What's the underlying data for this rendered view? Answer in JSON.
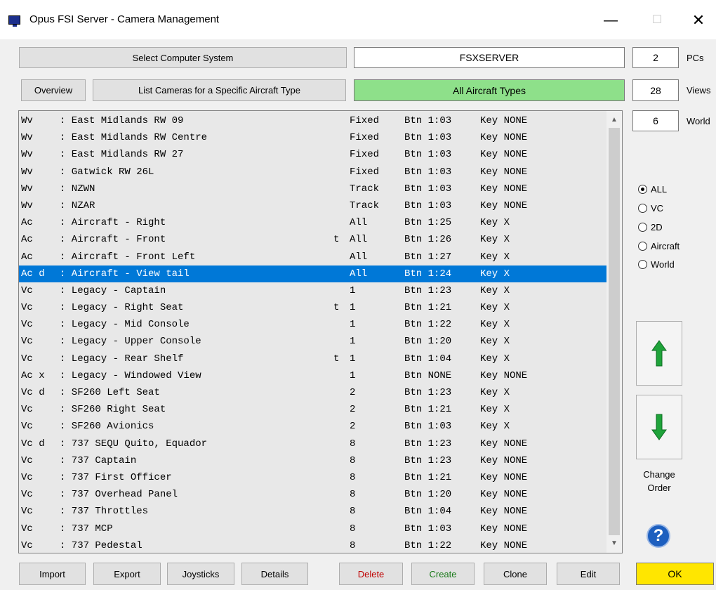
{
  "window": {
    "title": "Opus FSI Server - Camera Management",
    "minimize": "—",
    "maximize": "☐",
    "close": "✕"
  },
  "header": {
    "select_system_label": "Select Computer System",
    "system_value": "FSXSERVER",
    "pcs_count": "2",
    "pcs_label": "PCs",
    "overview_label": "Overview",
    "list_cameras_label": "List Cameras for a Specific Aircraft Type",
    "aircraft_filter": "All Aircraft Types",
    "views_count": "28",
    "views_label": "Views",
    "world_count": "6",
    "world_label": "World"
  },
  "camera_list": {
    "selected_index": 9,
    "rows": [
      {
        "type": "Wv  ",
        "name": ": East Midlands RW 09",
        "flag": "",
        "view": "Fixed",
        "btn": "Btn 1:03",
        "key": "Key NONE"
      },
      {
        "type": "Wv  ",
        "name": ": East Midlands RW Centre",
        "flag": "",
        "view": "Fixed",
        "btn": "Btn 1:03",
        "key": "Key NONE"
      },
      {
        "type": "Wv  ",
        "name": ": East Midlands RW 27",
        "flag": "",
        "view": "Fixed",
        "btn": "Btn 1:03",
        "key": "Key NONE"
      },
      {
        "type": "Wv  ",
        "name": ": Gatwick RW 26L",
        "flag": "",
        "view": "Fixed",
        "btn": "Btn 1:03",
        "key": "Key NONE"
      },
      {
        "type": "Wv  ",
        "name": ": NZWN",
        "flag": "",
        "view": "Track",
        "btn": "Btn 1:03",
        "key": "Key NONE"
      },
      {
        "type": "Wv  ",
        "name": ": NZAR",
        "flag": "",
        "view": "Track",
        "btn": "Btn 1:03",
        "key": "Key NONE"
      },
      {
        "type": "Ac  ",
        "name": ": Aircraft - Right",
        "flag": "",
        "view": "All",
        "btn": "Btn 1:25",
        "key": "Key X"
      },
      {
        "type": "Ac  ",
        "name": ": Aircraft - Front",
        "flag": "t",
        "view": "All",
        "btn": "Btn 1:26",
        "key": "Key X"
      },
      {
        "type": "Ac  ",
        "name": ": Aircraft - Front Left",
        "flag": "",
        "view": "All",
        "btn": "Btn 1:27",
        "key": "Key X"
      },
      {
        "type": "Ac d",
        "name": ": Aircraft - View tail",
        "flag": "",
        "view": "All",
        "btn": "Btn 1:24",
        "key": "Key X"
      },
      {
        "type": "Vc  ",
        "name": ": Legacy - Captain",
        "flag": "",
        "view": "1",
        "btn": "Btn 1:23",
        "key": "Key X"
      },
      {
        "type": "Vc  ",
        "name": ": Legacy - Right Seat",
        "flag": "t",
        "view": "1",
        "btn": "Btn 1:21",
        "key": "Key X"
      },
      {
        "type": "Vc  ",
        "name": ": Legacy - Mid Console",
        "flag": "",
        "view": "1",
        "btn": "Btn 1:22",
        "key": "Key X"
      },
      {
        "type": "Vc  ",
        "name": ": Legacy - Upper Console",
        "flag": "",
        "view": "1",
        "btn": "Btn 1:20",
        "key": "Key X"
      },
      {
        "type": "Vc  ",
        "name": ": Legacy - Rear Shelf",
        "flag": "t",
        "view": "1",
        "btn": "Btn 1:04",
        "key": "Key X"
      },
      {
        "type": "Ac x",
        "name": ": Legacy - Windowed View",
        "flag": "",
        "view": "1",
        "btn": "Btn NONE",
        "key": "Key NONE"
      },
      {
        "type": "Vc d",
        "name": ": SF260 Left Seat",
        "flag": "",
        "view": "2",
        "btn": "Btn 1:23",
        "key": "Key X"
      },
      {
        "type": "Vc  ",
        "name": ": SF260 Right Seat",
        "flag": "",
        "view": "2",
        "btn": "Btn 1:21",
        "key": "Key X"
      },
      {
        "type": "Vc  ",
        "name": ": SF260 Avionics",
        "flag": "",
        "view": "2",
        "btn": "Btn 1:03",
        "key": "Key X"
      },
      {
        "type": "Vc d",
        "name": ": 737 SEQU Quito, Equador",
        "flag": "",
        "view": "8",
        "btn": "Btn 1:23",
        "key": "Key NONE"
      },
      {
        "type": "Vc  ",
        "name": ": 737 Captain",
        "flag": "",
        "view": "8",
        "btn": "Btn 1:23",
        "key": "Key NONE"
      },
      {
        "type": "Vc  ",
        "name": ": 737 First Officer",
        "flag": "",
        "view": "8",
        "btn": "Btn 1:21",
        "key": "Key NONE"
      },
      {
        "type": "Vc  ",
        "name": ": 737 Overhead Panel",
        "flag": "",
        "view": "8",
        "btn": "Btn 1:20",
        "key": "Key NONE"
      },
      {
        "type": "Vc  ",
        "name": ": 737 Throttles",
        "flag": "",
        "view": "8",
        "btn": "Btn 1:04",
        "key": "Key NONE"
      },
      {
        "type": "Vc  ",
        "name": ": 737 MCP",
        "flag": "",
        "view": "8",
        "btn": "Btn 1:03",
        "key": "Key NONE"
      },
      {
        "type": "Vc  ",
        "name": ": 737 Pedestal",
        "flag": "",
        "view": "8",
        "btn": "Btn 1:22",
        "key": "Key NONE"
      }
    ]
  },
  "filter_options": [
    {
      "label": "ALL",
      "selected": true
    },
    {
      "label": "VC",
      "selected": false
    },
    {
      "label": "2D",
      "selected": false
    },
    {
      "label": "Aircraft",
      "selected": false
    },
    {
      "label": "World",
      "selected": false
    }
  ],
  "order": {
    "label_line1": "Change",
    "label_line2": "Order",
    "up_icon": "arrow-up-icon",
    "down_icon": "arrow-down-icon"
  },
  "help": {
    "glyph": "?"
  },
  "footer": {
    "import_label": "Import",
    "export_label": "Export",
    "joysticks_label": "Joysticks",
    "details_label": "Details",
    "delete_label": "Delete",
    "create_label": "Create",
    "clone_label": "Clone",
    "edit_label": "Edit",
    "ok_label": "OK"
  },
  "colors": {
    "selection": "#0078d7",
    "aircraft_filter_bg": "#8ee08a",
    "ok_bg": "#ffe600",
    "delete_text": "#c00000",
    "create_text": "#1a7a1a",
    "arrow_green": "#1fa33a"
  }
}
